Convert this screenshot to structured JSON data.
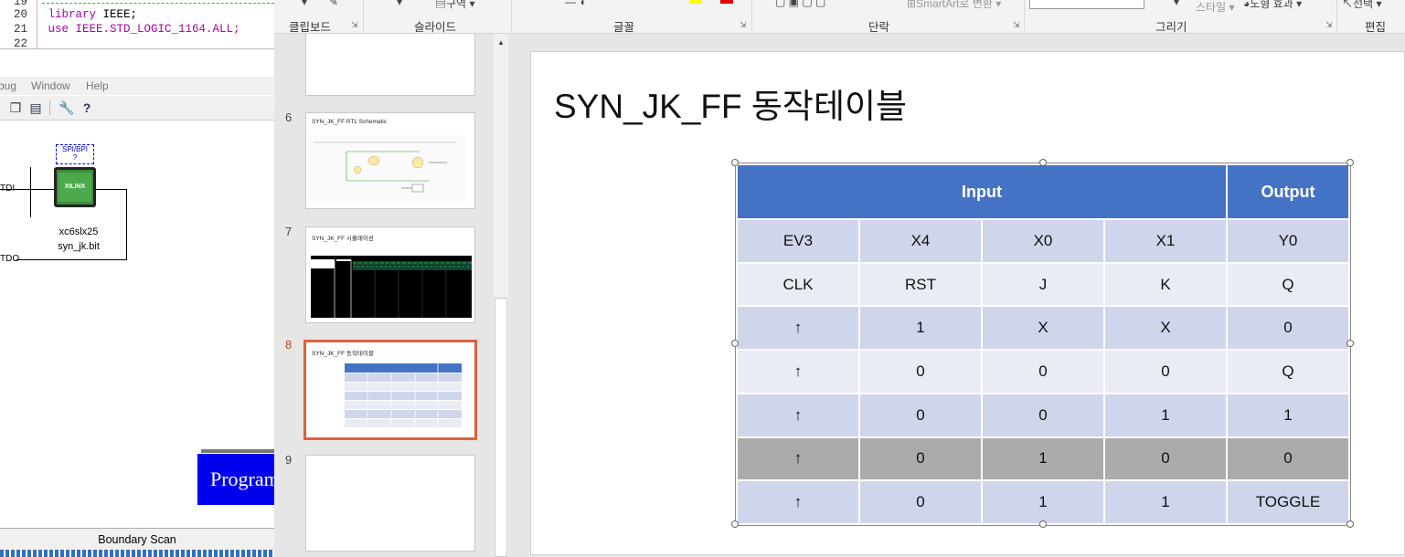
{
  "ide": {
    "code_lines": [
      {
        "num": "19",
        "text": ""
      },
      {
        "num": "20",
        "kw": "library",
        "rest": " IEEE;"
      },
      {
        "num": "21",
        "kw": "use",
        "rest": " IEEE.STD_LOGIC_1164.ALL;"
      },
      {
        "num": "22",
        "text": ""
      }
    ],
    "menu": [
      "bug",
      "Window",
      "Help"
    ],
    "chain": {
      "tdi_label": "TDI",
      "tdo_label": "TDO",
      "spi_bpi": "SPI/BPI",
      "spi_q": "?",
      "chip_logo": "XILINX",
      "device": "xc6slx25",
      "bitfile": "syn_jk.bit"
    },
    "program_label": "Program",
    "boundary_scan": "Boundary Scan"
  },
  "ribbon": {
    "groups": [
      "클립보드",
      "슬라이드",
      "글꼴",
      "단락",
      "그리기",
      "편집"
    ],
    "top_partial": {
      "section": "구역",
      "smartart": "SmartArt로 변환",
      "style": "스타일",
      "effect": "도형 효과",
      "select": "선택"
    }
  },
  "thumbnails": [
    {
      "num": "",
      "title": ""
    },
    {
      "num": "6",
      "title": "SYN_JK_FF RTL Schematic"
    },
    {
      "num": "7",
      "title": "SYN_JK_FF 시뮬레이션"
    },
    {
      "num": "8",
      "title": "SYN_JK_FF 동작테이블"
    },
    {
      "num": "9",
      "title": ""
    }
  ],
  "slide": {
    "title": "SYN_JK_FF 동작테이블",
    "table": {
      "header": {
        "input": "Input",
        "output": "Output"
      },
      "rows": [
        [
          "EV3",
          "X4",
          "X0",
          "X1",
          "Y0"
        ],
        [
          "CLK",
          "RST",
          "J",
          "K",
          "Q"
        ],
        [
          "↑",
          "1",
          "X",
          "X",
          "0"
        ],
        [
          "↑",
          "0",
          "0",
          "0",
          "Q"
        ],
        [
          "↑",
          "0",
          "0",
          "1",
          "1"
        ],
        [
          "↑",
          "0",
          "1",
          "0",
          "0"
        ],
        [
          "↑",
          "0",
          "1",
          "1",
          "TOGGLE"
        ]
      ]
    }
  },
  "colors": {
    "table_header": "#4472c4",
    "row_dark": "#cfd5ea",
    "row_light": "#e9ebf5",
    "row_highlight": "#ababab",
    "program_button": "#0000ee",
    "selected_thumb_border": "#e06040"
  }
}
